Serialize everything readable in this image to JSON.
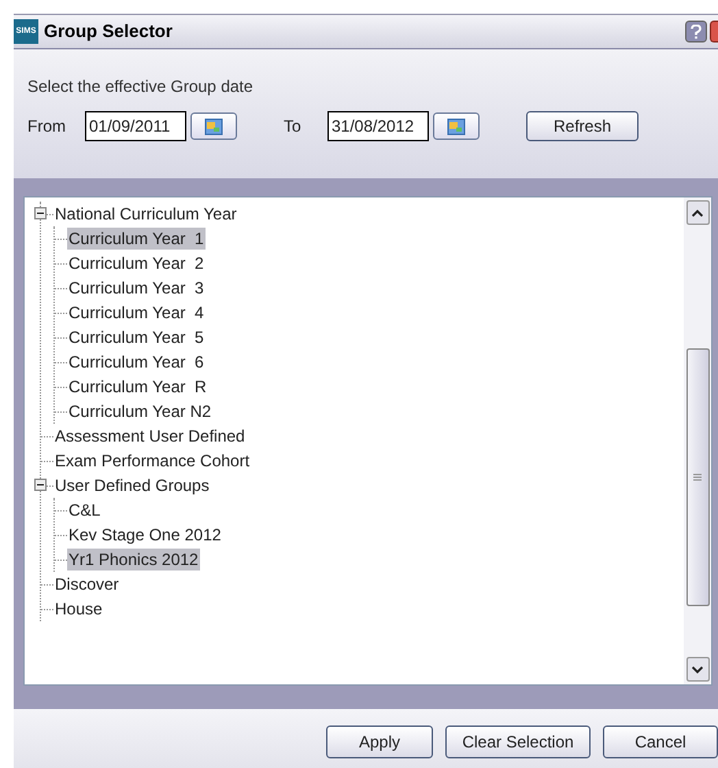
{
  "window": {
    "title": "Group Selector",
    "logo": "SIMS"
  },
  "date_prompt": "Select the effective Group date",
  "from": {
    "label": "From",
    "value": "01/09/2011"
  },
  "to": {
    "label": "To",
    "value": "31/08/2012"
  },
  "refresh_button": "Refresh",
  "tree": [
    {
      "label": "National Curriculum Year",
      "selected": false,
      "expanded": true,
      "children": [
        {
          "label": "Curriculum Year  1",
          "selected": true
        },
        {
          "label": "Curriculum Year  2",
          "selected": false
        },
        {
          "label": "Curriculum Year  3",
          "selected": false
        },
        {
          "label": "Curriculum Year  4",
          "selected": false
        },
        {
          "label": "Curriculum Year  5",
          "selected": false
        },
        {
          "label": "Curriculum Year  6",
          "selected": false
        },
        {
          "label": "Curriculum Year  R",
          "selected": false
        },
        {
          "label": "Curriculum Year N2",
          "selected": false
        }
      ]
    },
    {
      "label": "Assessment User Defined",
      "selected": false
    },
    {
      "label": "Exam Performance Cohort",
      "selected": false
    },
    {
      "label": "User Defined Groups",
      "selected": false,
      "expanded": true,
      "children": [
        {
          "label": "C&L",
          "selected": false
        },
        {
          "label": "Kev Stage One 2012",
          "selected": false
        },
        {
          "label": "Yr1 Phonics 2012",
          "selected": true
        }
      ]
    },
    {
      "label": "Discover",
      "selected": false
    },
    {
      "label": "House",
      "selected": false
    }
  ],
  "buttons": [
    "Apply",
    "Clear Selection",
    "Cancel"
  ]
}
